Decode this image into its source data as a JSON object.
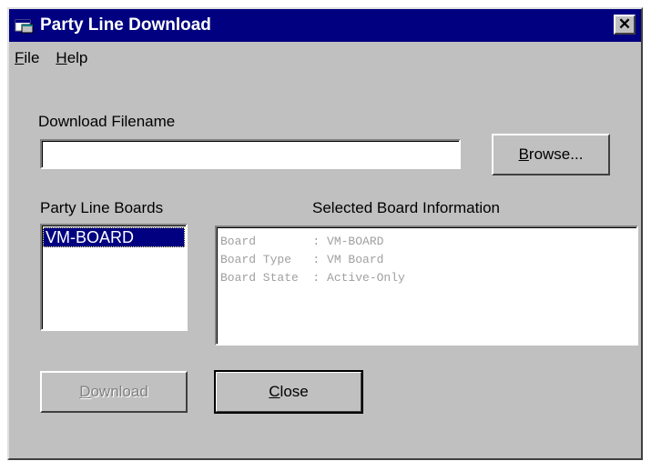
{
  "window": {
    "title": "Party Line Download",
    "close_glyph": "✕"
  },
  "menu": {
    "file": {
      "mnemonic": "F",
      "rest": "ile"
    },
    "help": {
      "mnemonic": "H",
      "rest": "elp"
    }
  },
  "download_filename": {
    "label": "Download Filename",
    "value": ""
  },
  "browse_button": {
    "mnemonic": "B",
    "rest": "rowse..."
  },
  "boards": {
    "label": "Party Line Boards",
    "items": [
      "VM-BOARD"
    ]
  },
  "board_info": {
    "label": "Selected Board Information",
    "lines": [
      "Board        : VM-BOARD",
      "Board Type   : VM Board",
      "Board State  : Active-Only"
    ]
  },
  "download_button": {
    "mnemonic": "D",
    "rest": "ownload",
    "enabled": false
  },
  "close_button": {
    "mnemonic": "C",
    "rest": "lose"
  },
  "colors": {
    "titlebar": "#000080",
    "face": "#c0c0c0",
    "selection": "#000080",
    "disabled_text": "#808080"
  }
}
